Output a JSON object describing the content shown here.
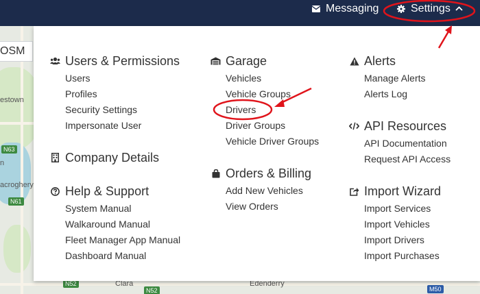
{
  "topbar": {
    "messaging_label": "Messaging",
    "settings_label": "Settings"
  },
  "map": {
    "tab_label": "OSM",
    "labels": [
      "estown",
      "N63",
      "n",
      "acroghery",
      "N61",
      "Clara",
      "Edenderry",
      "N52",
      "N52",
      "M50"
    ]
  },
  "menu": {
    "users_permissions": {
      "title": "Users & Permissions",
      "items": [
        "Users",
        "Profiles",
        "Security Settings",
        "Impersonate User"
      ]
    },
    "company_details": {
      "title": "Company Details"
    },
    "help_support": {
      "title": "Help & Support",
      "items": [
        "System Manual",
        "Walkaround Manual",
        "Fleet Manager App Manual",
        "Dashboard Manual"
      ]
    },
    "garage": {
      "title": "Garage",
      "items": [
        "Vehicles",
        "Vehicle Groups",
        "Drivers",
        "Driver Groups",
        "Vehicle Driver Groups"
      ]
    },
    "orders_billing": {
      "title": "Orders & Billing",
      "items": [
        "Add New Vehicles",
        "View Orders"
      ]
    },
    "alerts": {
      "title": "Alerts",
      "items": [
        "Manage Alerts",
        "Alerts Log"
      ]
    },
    "api_resources": {
      "title": "API Resources",
      "items": [
        "API Documentation",
        "Request API Access"
      ]
    },
    "import_wizard": {
      "title": "Import Wizard",
      "items": [
        "Import Services",
        "Import Vehicles",
        "Import Drivers",
        "Import Purchases"
      ]
    }
  },
  "colors": {
    "topbar": "#1c2b4b",
    "annotation": "#e0141b",
    "text": "#333333"
  },
  "icons": {
    "messaging": "envelope-icon",
    "settings": "gear-icon",
    "users": "users-icon",
    "company": "building-icon",
    "help": "question-circle-icon",
    "garage": "garage-icon",
    "orders": "shopping-bag-icon",
    "alerts": "warning-triangle-icon",
    "api": "code-icon",
    "import": "share-square-icon"
  }
}
